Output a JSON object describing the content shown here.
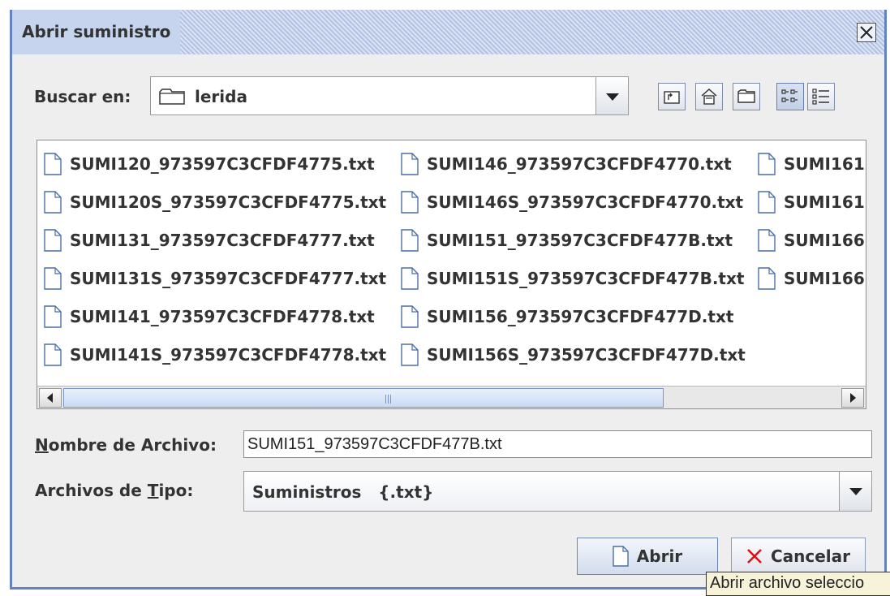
{
  "window": {
    "title": "Abrir suministro"
  },
  "look_in": {
    "label": "Buscar en:",
    "value": "lerida"
  },
  "toolbar": [
    {
      "name": "up-folder-button",
      "icon": "up-folder-icon"
    },
    {
      "name": "home-button",
      "icon": "home-icon"
    },
    {
      "name": "new-folder-button",
      "icon": "new-folder-icon"
    },
    {
      "name": "list-view-button",
      "icon": "list-view-icon",
      "active": true
    },
    {
      "name": "details-view-button",
      "icon": "details-view-icon"
    }
  ],
  "files": [
    "SUMI120_973597C3CFDF4775.txt",
    "SUMI120S_973597C3CFDF4775.txt",
    "SUMI131_973597C3CFDF4777.txt",
    "SUMI131S_973597C3CFDF4777.txt",
    "SUMI141_973597C3CFDF4778.txt",
    "SUMI141S_973597C3CFDF4778.txt",
    "SUMI146_973597C3CFDF4770.txt",
    "SUMI146S_973597C3CFDF4770.txt",
    "SUMI151_973597C3CFDF477B.txt",
    "SUMI151S_973597C3CFDF477B.txt",
    "SUMI156_973597C3CFDF477D.txt",
    "SUMI156S_973597C3CFDF477D.txt",
    "SUMI161",
    "SUMI161",
    "SUMI166",
    "SUMI166"
  ],
  "filename": {
    "label_mnemonic": "N",
    "label_rest": "ombre de Archivo:",
    "value": "SUMI151_973597C3CFDF477B.txt"
  },
  "filetype": {
    "label_pre": "Archivos de ",
    "label_mnemonic": "T",
    "label_post": "ipo:",
    "value": "Suministros   {.txt}"
  },
  "buttons": {
    "open": "Abrir",
    "cancel": "Cancelar"
  },
  "tooltip": "Abrir archivo seleccio",
  "colors": {
    "title_bar": "#c7d4ee",
    "border": "#6382bf",
    "cancel_icon": "#dd1111"
  }
}
